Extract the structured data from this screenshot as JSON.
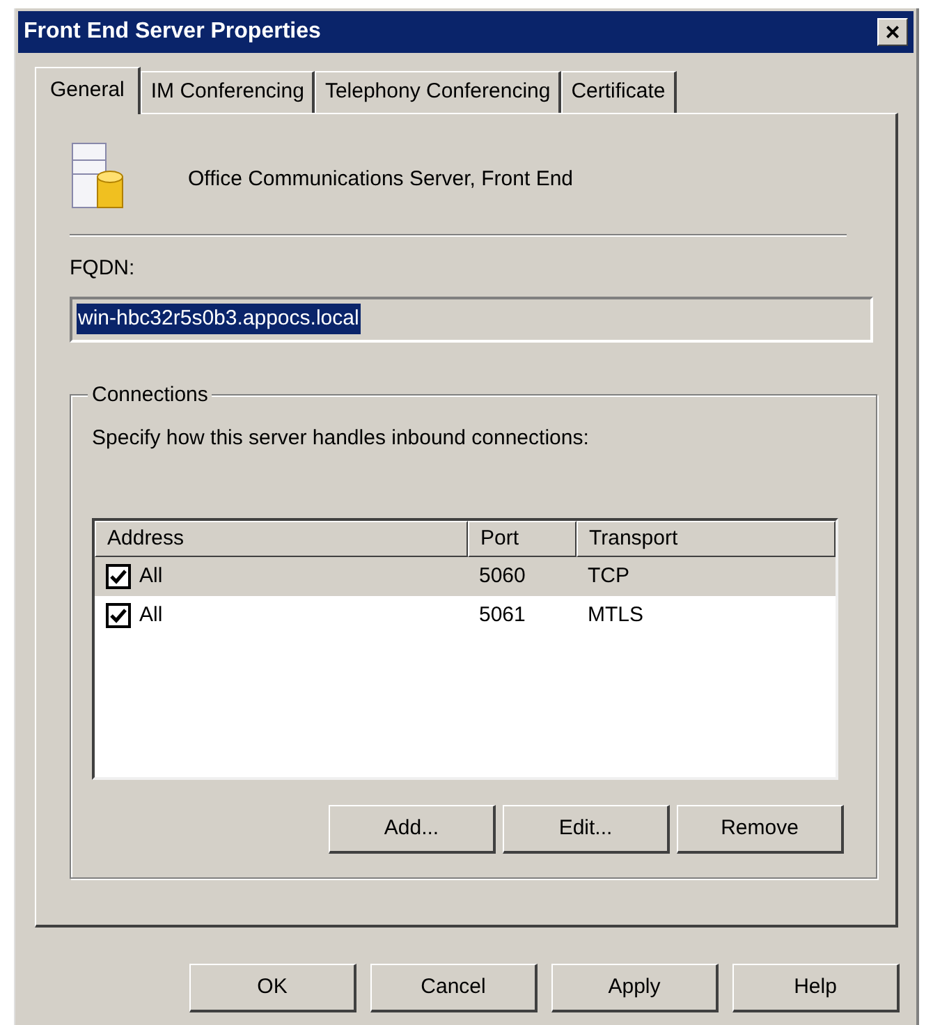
{
  "window": {
    "title": "Front End Server Properties",
    "close": "×"
  },
  "tabs": [
    {
      "label": "General",
      "selected": true
    },
    {
      "label": "IM Conferencing",
      "selected": false
    },
    {
      "label": "Telephony Conferencing",
      "selected": false
    },
    {
      "label": "Certificate",
      "selected": false
    }
  ],
  "header": {
    "text": "Office Communications Server, Front End"
  },
  "fqdn": {
    "label": "FQDN:",
    "value": "win-hbc32r5s0b3.appocs.local"
  },
  "connections": {
    "title": "Connections",
    "description": "Specify how this server handles inbound connections:",
    "columns": [
      "Address",
      "Port",
      "Transport"
    ],
    "rows": [
      {
        "checked": true,
        "selected": true,
        "cells": [
          "All",
          "5060",
          "TCP"
        ]
      },
      {
        "checked": true,
        "selected": false,
        "cells": [
          "All",
          "5061",
          "MTLS"
        ]
      }
    ],
    "buttons": [
      "Add...",
      "Edit...",
      "Remove"
    ]
  },
  "buttons": [
    "OK",
    "Cancel",
    "Apply",
    "Help"
  ]
}
